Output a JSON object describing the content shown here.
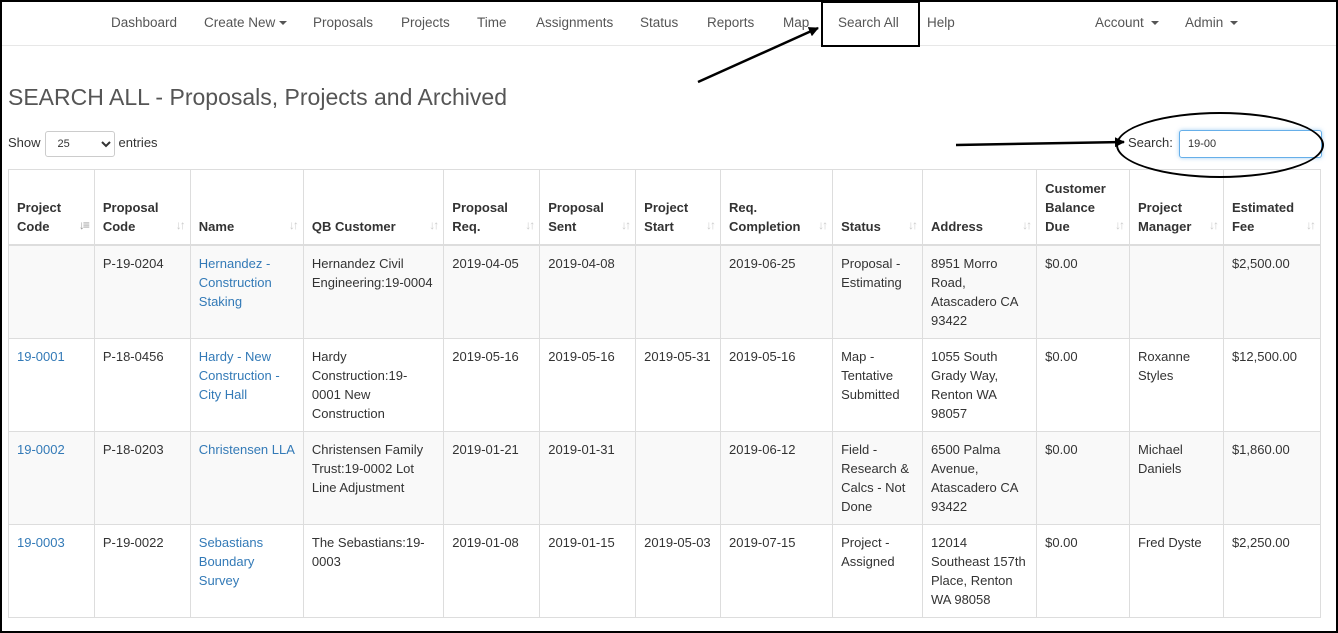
{
  "nav": {
    "items": [
      {
        "label": "Dashboard",
        "dropdown": false
      },
      {
        "label": "Create New",
        "dropdown": true
      },
      {
        "label": "Proposals",
        "dropdown": false
      },
      {
        "label": "Projects",
        "dropdown": false
      },
      {
        "label": "Time",
        "dropdown": false
      },
      {
        "label": "Assignments",
        "dropdown": false
      },
      {
        "label": "Status",
        "dropdown": false
      },
      {
        "label": "Reports",
        "dropdown": false
      },
      {
        "label": "Map",
        "dropdown": false
      },
      {
        "label": "Search All",
        "dropdown": false,
        "highlighted": true
      },
      {
        "label": "Help",
        "dropdown": false
      }
    ],
    "right": [
      {
        "label": "Account",
        "dropdown": true
      },
      {
        "label": "Admin",
        "dropdown": true
      }
    ]
  },
  "page": {
    "title": "SEARCH ALL - Proposals, Projects and Archived"
  },
  "length_control": {
    "show_label": "Show",
    "value": "25",
    "entries_label": "entries"
  },
  "search": {
    "label": "Search:",
    "value": "19-00"
  },
  "table": {
    "columns": [
      [
        "Project",
        "Code"
      ],
      [
        "Proposal",
        "Code"
      ],
      [
        "Name"
      ],
      [
        "QB Customer"
      ],
      [
        "Proposal",
        "Req."
      ],
      [
        "Proposal",
        "Sent"
      ],
      [
        "Project",
        "Start"
      ],
      [
        "Req.",
        "Completion"
      ],
      [
        "Status"
      ],
      [
        "Address"
      ],
      [
        "Customer",
        "Balance",
        "Due"
      ],
      [
        "Project",
        "Manager"
      ],
      [
        "Estimated",
        "Fee"
      ]
    ],
    "sorted_column": 0,
    "rows": [
      {
        "project_code": "",
        "proposal_code": "P-19-0204",
        "name": "Hernandez - Construction Staking",
        "qb_customer": "Hernandez Civil Engineering:19-0004",
        "proposal_req": "2019-04-05",
        "proposal_sent": "2019-04-08",
        "project_start": "",
        "req_completion": "2019-06-25",
        "status": "Proposal - Estimating",
        "address": "8951 Morro Road, Atascadero CA 93422",
        "balance_due": "$0.00",
        "project_manager": "",
        "estimated_fee": "$2,500.00"
      },
      {
        "project_code": "19-0001",
        "proposal_code": "P-18-0456",
        "name": "Hardy - New Construction - City Hall",
        "qb_customer": "Hardy Construction:19-0001 New Construction",
        "proposal_req": "2019-05-16",
        "proposal_sent": "2019-05-16",
        "project_start": "2019-05-31",
        "req_completion": "2019-05-16",
        "status": "Map - Tentative Submitted",
        "address": "1055 South Grady Way, Renton WA 98057",
        "balance_due": "$0.00",
        "project_manager": "Roxanne Styles",
        "estimated_fee": "$12,500.00"
      },
      {
        "project_code": "19-0002",
        "proposal_code": "P-18-0203",
        "name": "Christensen LLA",
        "qb_customer": "Christensen Family Trust:19-0002 Lot Line Adjustment",
        "proposal_req": "2019-01-21",
        "proposal_sent": "2019-01-31",
        "project_start": "",
        "req_completion": "2019-06-12",
        "status": "Field - Research & Calcs - Not Done",
        "address": "6500 Palma Avenue, Atascadero CA 93422",
        "balance_due": "$0.00",
        "project_manager": "Michael Daniels",
        "estimated_fee": "$1,860.00"
      },
      {
        "project_code": "19-0003",
        "proposal_code": "P-19-0022",
        "name": "Sebastians Boundary Survey",
        "qb_customer": "The Sebastians:19-0003",
        "proposal_req": "2019-01-08",
        "proposal_sent": "2019-01-15",
        "project_start": "2019-05-03",
        "req_completion": "2019-07-15",
        "status": "Project - Assigned",
        "address": "12014 Southeast 157th Place, Renton WA 98058",
        "balance_due": "$0.00",
        "project_manager": "Fred Dyste",
        "estimated_fee": "$2,250.00"
      }
    ]
  },
  "colors": {
    "link": "#337ab7",
    "nav_text": "#555555",
    "stripe": "#f9f9f9",
    "border": "#dddddd"
  },
  "icons": {
    "sort": "sort-arrows-icon",
    "caret": "caret-down-icon"
  }
}
